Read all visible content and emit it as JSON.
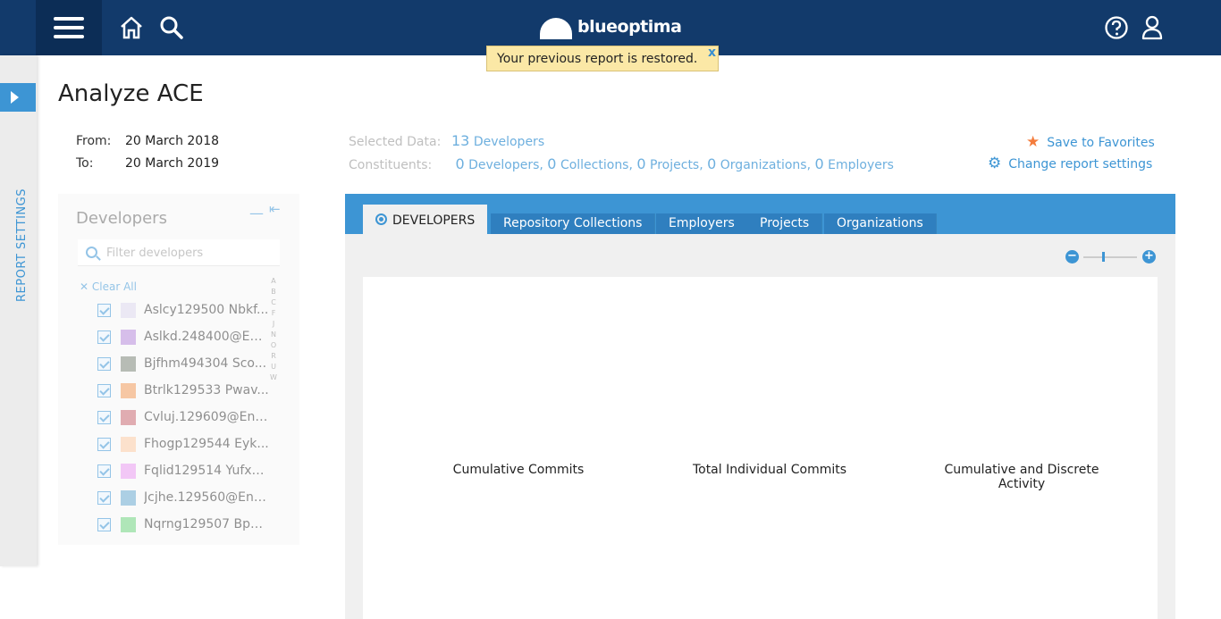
{
  "header": {
    "logo_text": "blueoptima",
    "icons": [
      "menu-icon",
      "home-icon",
      "search-icon",
      "help-icon",
      "user-icon"
    ]
  },
  "toast": {
    "message": "Your previous report is restored.",
    "close": "x"
  },
  "rail": {
    "label": "REPORT SETTINGS"
  },
  "page": {
    "title": "Analyze ACE"
  },
  "dates": {
    "from_label": "From:",
    "from_value": "20 March 2018",
    "to_label": "To:",
    "to_value": "20 March 2019"
  },
  "developers_panel": {
    "title": "Developers",
    "filter_placeholder": "Filter developers",
    "clear_all": "Clear All",
    "alphabet": [
      "A",
      "B",
      "C",
      "F",
      "J",
      "N",
      "O",
      "R",
      "U",
      "W"
    ],
    "items": [
      {
        "name": "Aslcy129500 Nbkf...",
        "color": "#dcd6ec"
      },
      {
        "name": "Aslkd.248400@En...",
        "color": "#b58ad9"
      },
      {
        "name": "Bjfhm494304 Sco...",
        "color": "#7d867a"
      },
      {
        "name": "Btrlk129533 Pwav...",
        "color": "#ef9a5b"
      },
      {
        "name": "Cvluj.129609@Ent...",
        "color": "#c86a72"
      },
      {
        "name": "Fhogp129544 Eyk...",
        "color": "#fbc9a4"
      },
      {
        "name": "Fqlid129514 Yufxn...",
        "color": "#e89af0"
      },
      {
        "name": "Jcjhe.129560@Ent...",
        "color": "#6aa8cf"
      },
      {
        "name": "Nqrng129507 Bpo...",
        "color": "#6fd27f"
      }
    ]
  },
  "selected": {
    "label": "Selected Data:",
    "count": "13",
    "count_text": "Developers",
    "constituents_label": "Constituents:",
    "constituents": [
      {
        "n": "0",
        "t": "Developers,"
      },
      {
        "n": "0",
        "t": "Collections,"
      },
      {
        "n": "0",
        "t": "Projects,"
      },
      {
        "n": "0",
        "t": "Organizations,"
      },
      {
        "n": "0",
        "t": "Employers"
      }
    ]
  },
  "actions": {
    "save_favorites": "Save to Favorites",
    "change_settings": "Change report settings"
  },
  "tabs": [
    "DEVELOPERS",
    "Repository Collections",
    "Employers",
    "Projects",
    "Organizations"
  ],
  "zoom": {
    "minus": "−",
    "plus": "+",
    "level": 0.35
  },
  "charts": {
    "c1": "Cumulative Commits",
    "c2": "Total Individual Commits",
    "c3": "Cumulative and Discrete Activity"
  },
  "colors": {
    "header": "#123a6b",
    "accent": "#3d95d4",
    "favorite": "#f47c3c",
    "toast_bg": "#fbe8a6"
  }
}
